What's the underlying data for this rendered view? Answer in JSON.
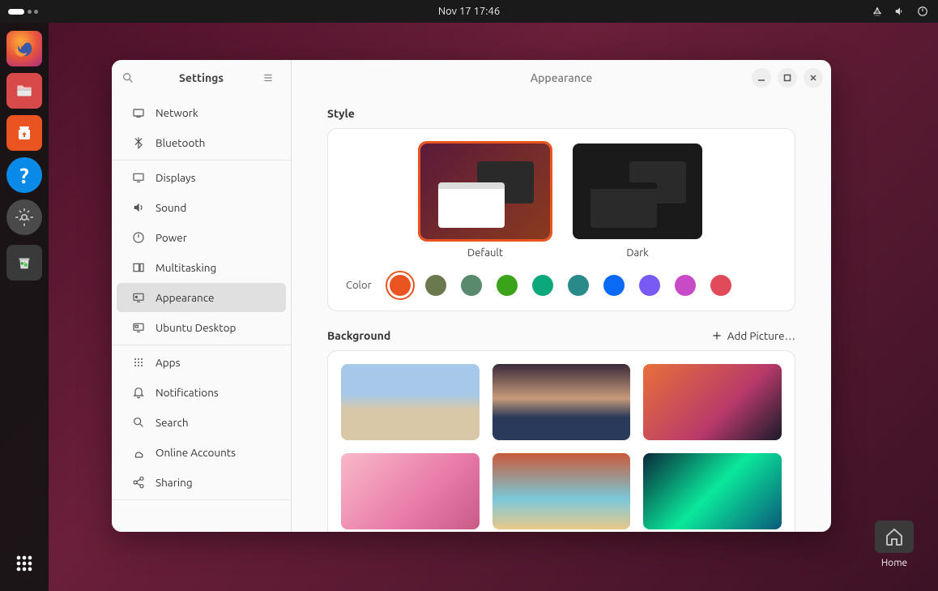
{
  "topbar": {
    "clock": "Nov 17  17:46"
  },
  "dock": {
    "items": [
      "firefox",
      "files",
      "software",
      "help",
      "settings",
      "trash"
    ]
  },
  "desktop": {
    "home_label": "Home"
  },
  "window": {
    "sidebar_title": "Settings",
    "content_title": "Appearance",
    "sections": [
      {
        "items": [
          {
            "id": "network",
            "label": "Network"
          },
          {
            "id": "bluetooth",
            "label": "Bluetooth"
          }
        ]
      },
      {
        "items": [
          {
            "id": "displays",
            "label": "Displays"
          },
          {
            "id": "sound",
            "label": "Sound"
          },
          {
            "id": "power",
            "label": "Power"
          },
          {
            "id": "multitasking",
            "label": "Multitasking"
          },
          {
            "id": "appearance",
            "label": "Appearance",
            "active": true
          },
          {
            "id": "ubuntu-desktop",
            "label": "Ubuntu Desktop"
          }
        ]
      },
      {
        "items": [
          {
            "id": "apps",
            "label": "Apps"
          },
          {
            "id": "notifications",
            "label": "Notifications"
          },
          {
            "id": "search",
            "label": "Search"
          },
          {
            "id": "online-accounts",
            "label": "Online Accounts"
          },
          {
            "id": "sharing",
            "label": "Sharing"
          }
        ]
      }
    ]
  },
  "appearance": {
    "style_label": "Style",
    "styles": [
      {
        "id": "default",
        "label": "Default",
        "selected": true
      },
      {
        "id": "dark",
        "label": "Dark",
        "selected": false
      }
    ],
    "color_label": "Color",
    "colors": [
      {
        "hex": "#e95420",
        "selected": true
      },
      {
        "hex": "#6b7a4e"
      },
      {
        "hex": "#5a8a6e"
      },
      {
        "hex": "#3aa31a"
      },
      {
        "hex": "#0aa87a"
      },
      {
        "hex": "#2a8a8a"
      },
      {
        "hex": "#0a6af5"
      },
      {
        "hex": "#7a5af5"
      },
      {
        "hex": "#c74ac7"
      },
      {
        "hex": "#e04a5a"
      }
    ],
    "background_label": "Background",
    "add_picture_label": "Add Picture…",
    "backgrounds": [
      {
        "id": "bg1",
        "gradient": "linear-gradient(180deg,#a7c8e8 40%,#d8c8a8 60%)"
      },
      {
        "id": "bg2",
        "gradient": "linear-gradient(180deg,#3a2a3a 0%,#c89a7a 45%,#2a3a5a 70%)"
      },
      {
        "id": "bg3",
        "gradient": "linear-gradient(135deg,#e8703a 0%,#b83a6a 60%,#1a1a2a 100%)"
      },
      {
        "id": "bg4",
        "gradient": "linear-gradient(135deg,#f8b8c8 0%,#e87aa8 60%,#c85a88 100%)"
      },
      {
        "id": "bg5",
        "gradient": "linear-gradient(180deg,#c85a3a 0%,#7ac8d8 60%,#e8c88a 100%)"
      },
      {
        "id": "bg6",
        "gradient": "linear-gradient(135deg,#0a2a3a 0%,#0ae89a 50%,#0a5a7a 100%)"
      }
    ]
  }
}
